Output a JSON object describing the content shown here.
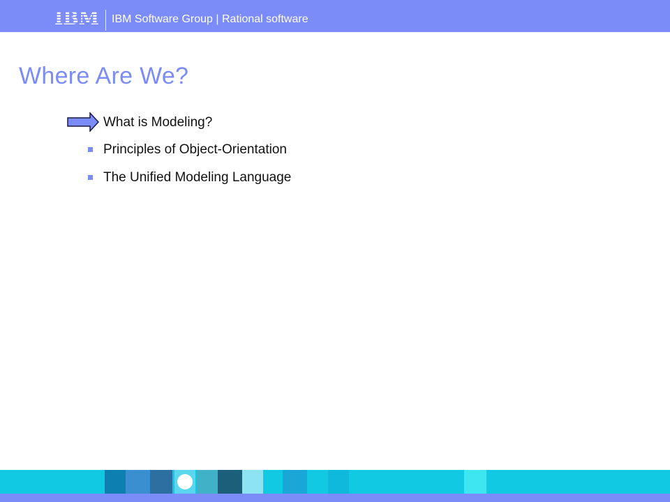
{
  "header": {
    "logo": "IBM",
    "text": "IBM Software Group | Rational software"
  },
  "slide": {
    "title": "Where Are We?",
    "items": [
      {
        "label": "What is Modeling?",
        "marker": "arrow-icon",
        "current": true
      },
      {
        "label": "Principles of Object-Orientation",
        "marker": "square-bullet-icon",
        "current": false
      },
      {
        "label": "The Unified Modeling Language",
        "marker": "square-bullet-icon",
        "current": false
      }
    ]
  },
  "colors": {
    "brand": "#7b8bf8",
    "footer_cyan": "#12c9e4",
    "text": "#111111"
  }
}
